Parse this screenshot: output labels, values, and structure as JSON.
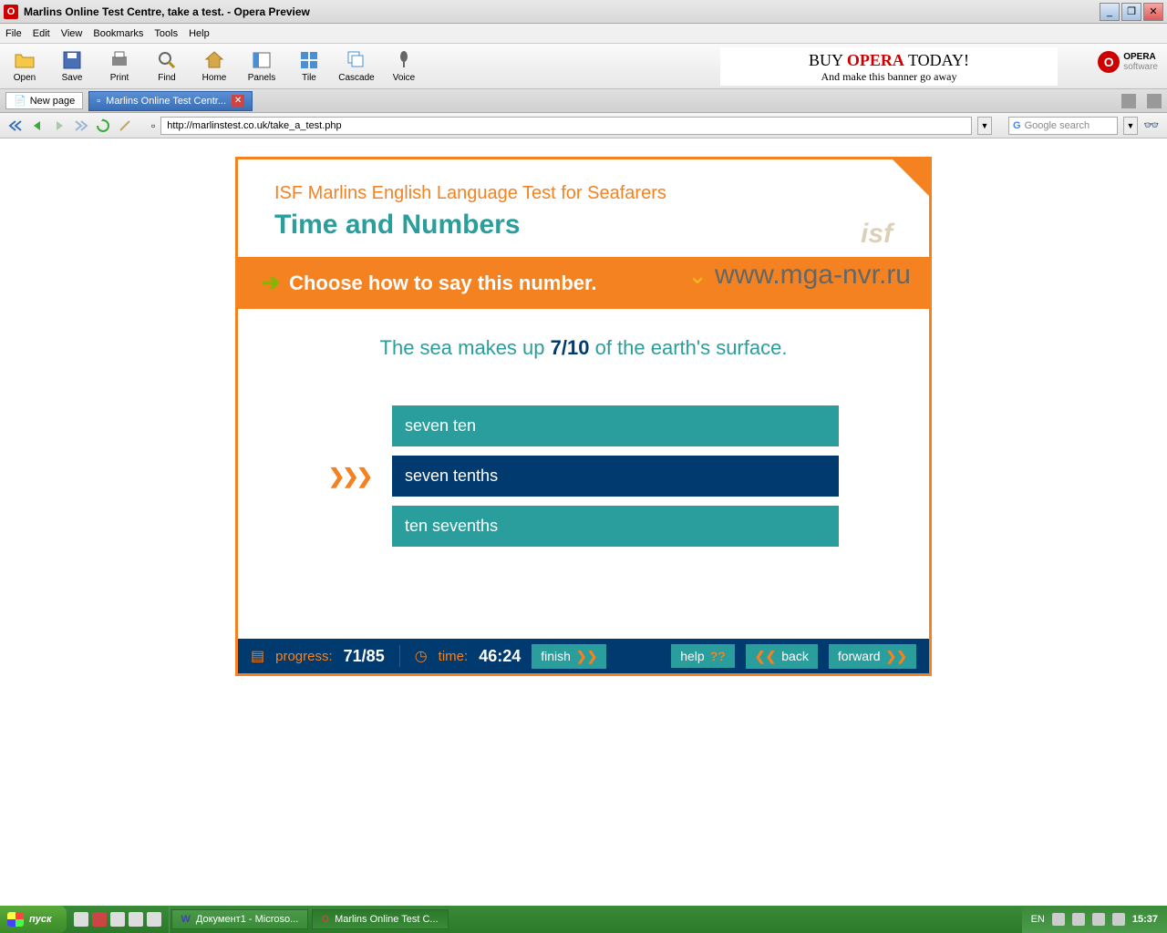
{
  "window": {
    "title": "Marlins Online Test Centre, take a test. - Opera Preview"
  },
  "menu": {
    "file": "File",
    "edit": "Edit",
    "view": "View",
    "bookmarks": "Bookmarks",
    "tools": "Tools",
    "help": "Help"
  },
  "toolbar": {
    "open": "Open",
    "save": "Save",
    "print": "Print",
    "find": "Find",
    "home": "Home",
    "panels": "Panels",
    "tile": "Tile",
    "cascade": "Cascade",
    "voice": "Voice"
  },
  "banner": {
    "buy": "BUY ",
    "opera": "OPERA",
    "today": " TODAY!",
    "sub": "And make this banner go away",
    "logo1": "OPERA",
    "logo2": "software"
  },
  "tabs": {
    "newpage": "New page",
    "active": "Marlins Online Test Centr..."
  },
  "address": {
    "url": "http://marlinstest.co.uk/take_a_test.php",
    "search_placeholder": "Google search"
  },
  "test": {
    "title1": "ISF Marlins English Language Test for Seafarers",
    "title2": "Time and Numbers",
    "watermark": "www.mga-nvr.ru",
    "instruction": "Choose how to say this number.",
    "question_pre": "The sea makes up ",
    "question_bold": "7/10",
    "question_post": " of the earth's surface.",
    "options": [
      "seven ten",
      "seven tenths",
      "ten sevenths"
    ],
    "selected_index": 1,
    "progress_label": "progress:",
    "progress_value": "71/85",
    "time_label": "time:",
    "time_value": "46:24",
    "btn_finish": "finish",
    "btn_help": "help",
    "btn_back": "back",
    "btn_forward": "forward",
    "help_q": "??"
  },
  "taskbar": {
    "start": "пуск",
    "task1": "Документ1 - Microso...",
    "task2": "Marlins Online Test C...",
    "lang": "EN",
    "clock": "15:37"
  }
}
